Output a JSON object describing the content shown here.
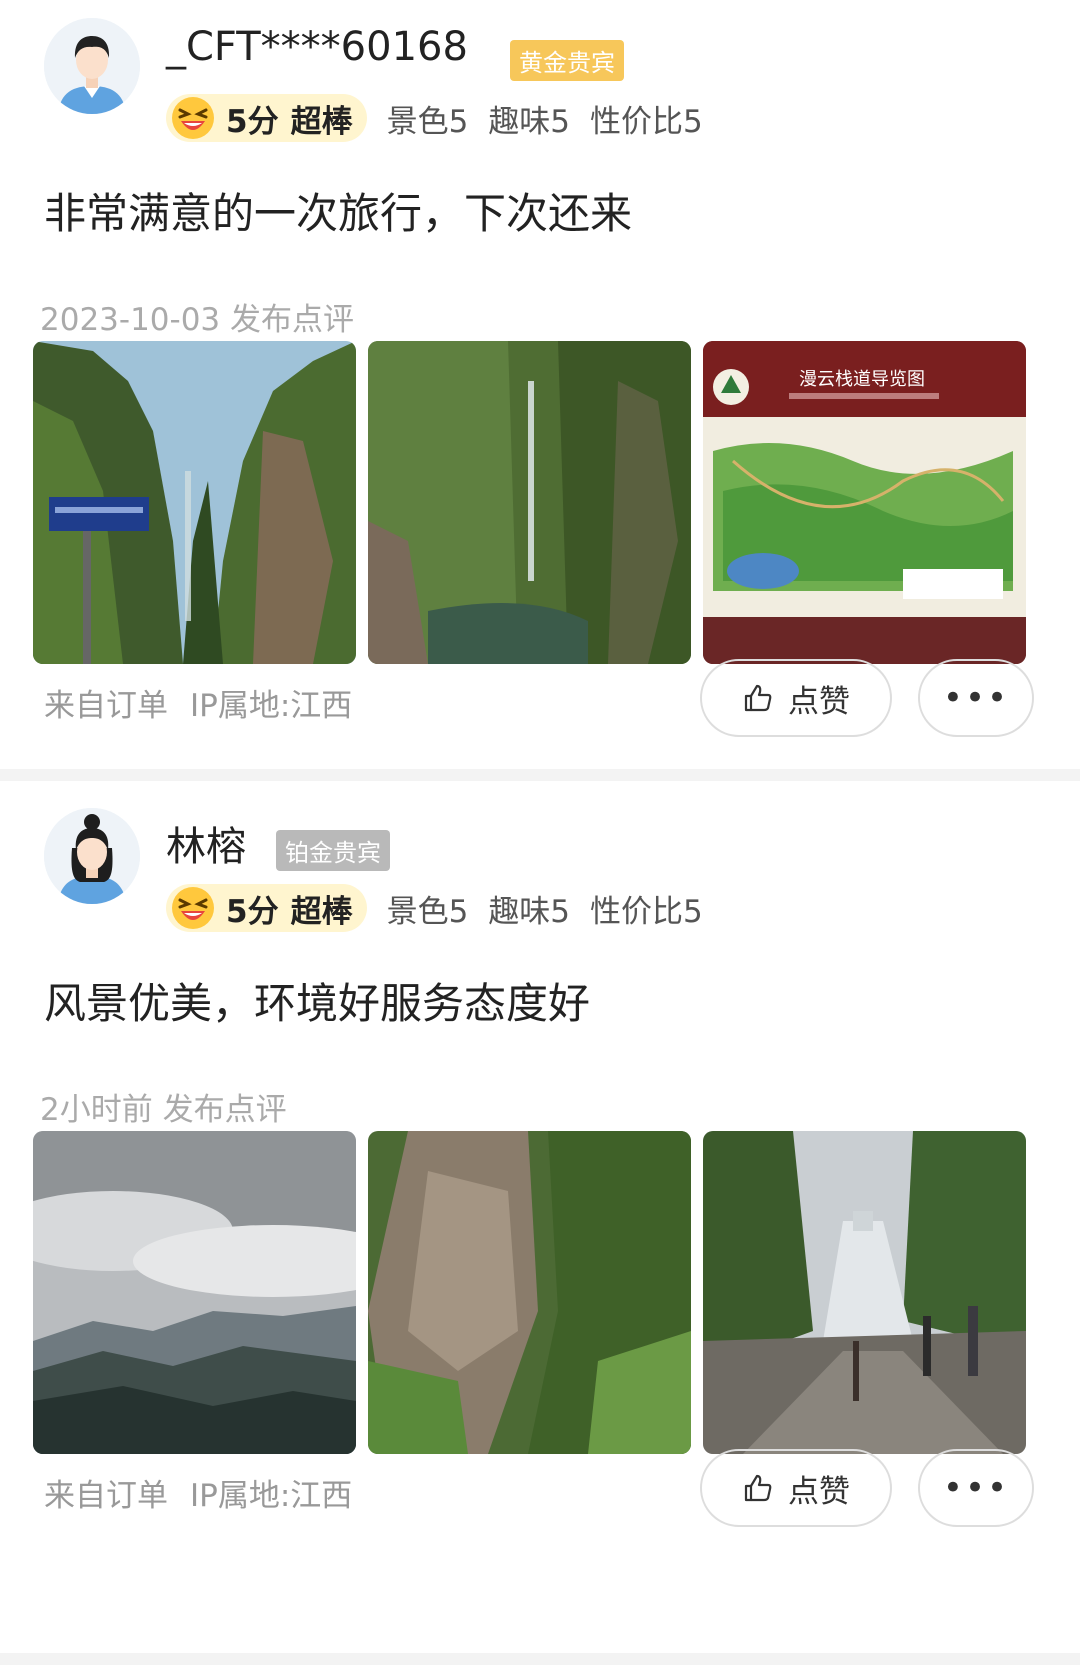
{
  "reviews": [
    {
      "username": "_CFT****60168",
      "badge": "黄金贵宾",
      "badge_color": "#f7c75a",
      "score": "5分",
      "score_word": "超棒",
      "sub_ratings": [
        "景色5",
        "趣味5",
        "性价比5"
      ],
      "content": "非常满意的一次旅行，下次还来",
      "date": "2023-10-03",
      "date_suffix": "发布点评",
      "source": "来自订单",
      "ip": "IP属地:江西",
      "like_label": "点赞",
      "more_label": "•••",
      "photos": [
        "gorge-with-sign",
        "waterfall-gorge",
        "trail-map-board"
      ],
      "map_board_title": "漫云栈道导览图"
    },
    {
      "username": "林榕",
      "badge": "铂金贵宾",
      "badge_color": "#b9b9b9",
      "score": "5分",
      "score_word": "超棒",
      "sub_ratings": [
        "景色5",
        "趣味5",
        "性价比5"
      ],
      "content": "风景优美，环境好服务态度好",
      "date": "2小时前",
      "date_suffix": "发布点评",
      "source": "来自订单",
      "ip": "IP属地:江西",
      "like_label": "点赞",
      "more_label": "•••",
      "photos": [
        "cloudy-mountains",
        "cliff-waterfall",
        "fountain-plaza"
      ]
    }
  ],
  "colors": {
    "rating_pill_bg": "#fff5cf",
    "muted_text": "#aaaaaa",
    "divider": "#f3f3f3"
  },
  "icons": [
    "male-avatar-icon",
    "female-avatar-icon",
    "laughing-face-icon",
    "thumbs-up-icon",
    "more-icon"
  ]
}
